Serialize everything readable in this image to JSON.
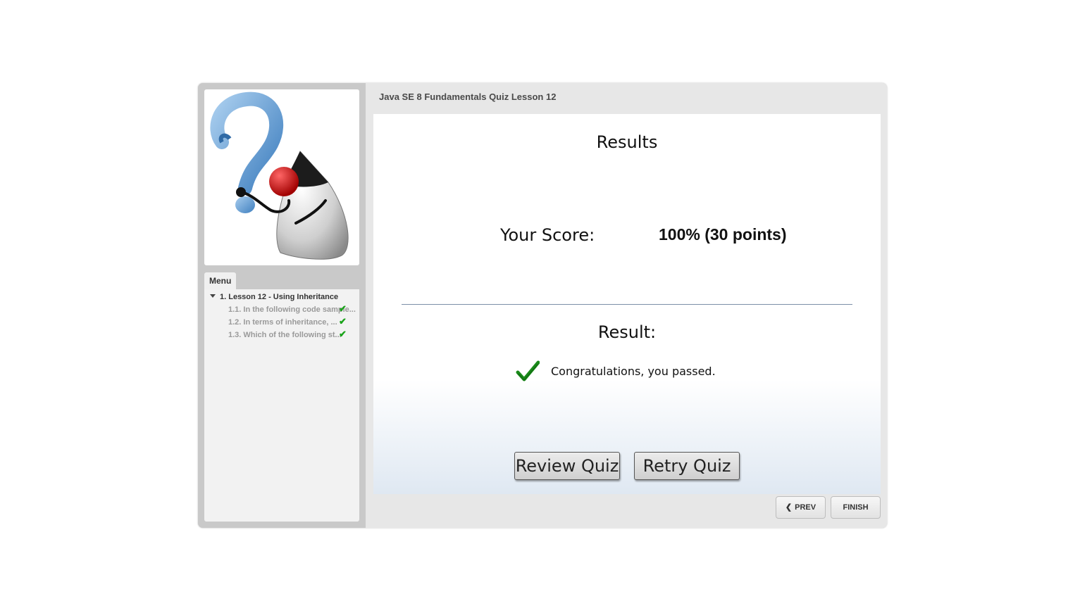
{
  "window": {
    "title": "Java SE 8 Fundamentals Quiz Lesson 12"
  },
  "sidebar": {
    "logo_icon": "duke-question-mark-icon",
    "menu_tab": "Menu",
    "lesson": "1. Lesson 12 - Using Inheritance",
    "questions": [
      {
        "label": "1.1. In the following code sample...",
        "status": "correct"
      },
      {
        "label": "1.2. In terms of inheritance, ...",
        "status": "correct"
      },
      {
        "label": "1.3. Which of the following st...",
        "status": "correct"
      }
    ]
  },
  "slide": {
    "heading": "Results",
    "score_label": "Your Score:",
    "score_value": "100% (30 points)",
    "result_label": "Result:",
    "result_message": "Congratulations, you passed.",
    "result_icon": "green-checkmark-icon",
    "review_button": "Review Quiz",
    "retry_button": "Retry Quiz"
  },
  "nav": {
    "prev_label": "PREV",
    "finish_label": "FINISH"
  },
  "colors": {
    "check_green": "#1a8a1a",
    "divider": "#7c8fa8"
  }
}
